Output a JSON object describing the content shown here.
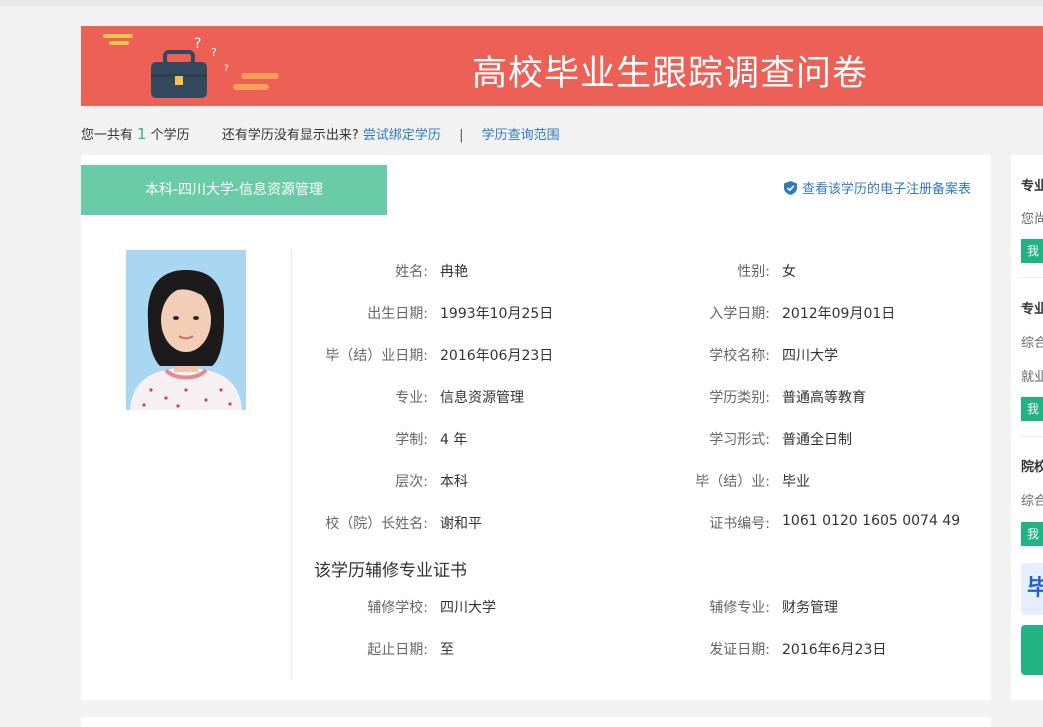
{
  "banner": {
    "title": "高校毕业生跟踪调查问卷"
  },
  "summary": {
    "prefix": "您一共有",
    "count": "1",
    "suffix": "个学历",
    "question": "还有学历没有显示出来?",
    "bind_link": "尝试绑定学历",
    "separator": "|",
    "range_link": "学历查询范围"
  },
  "record": {
    "tab_label": "本科-四川大学-信息资源管理",
    "reg_link": "查看该学历的电子注册备案表",
    "left_fields": [
      {
        "label": "姓名:",
        "value": "冉艳"
      },
      {
        "label": "出生日期:",
        "value": "1993年10月25日"
      },
      {
        "label": "毕（结）业日期:",
        "value": "2016年06月23日"
      },
      {
        "label": "专业:",
        "value": "信息资源管理"
      },
      {
        "label": "学制:",
        "value": "4 年"
      },
      {
        "label": "层次:",
        "value": "本科"
      },
      {
        "label": "校（院）长姓名:",
        "value": "谢和平"
      }
    ],
    "right_fields": [
      {
        "label": "性别:",
        "value": "女"
      },
      {
        "label": "入学日期:",
        "value": "2012年09月01日"
      },
      {
        "label": "学校名称:",
        "value": "四川大学"
      },
      {
        "label": "学历类别:",
        "value": "普通高等教育"
      },
      {
        "label": "学习形式:",
        "value": "普通全日制"
      },
      {
        "label": "毕（结）业:",
        "value": "毕业"
      },
      {
        "label": "证书编号:",
        "value": "1061 0120 1605 0074 49"
      }
    ],
    "minor_title": "该学历辅修专业证书",
    "minor_left": [
      {
        "label": "辅修学校:",
        "value": "四川大学"
      },
      {
        "label": "起止日期:",
        "value": "至"
      }
    ],
    "minor_right": [
      {
        "label": "辅修专业:",
        "value": "财务管理"
      },
      {
        "label": "发证日期:",
        "value": "2016年6月23日"
      }
    ]
  },
  "sidebar": {
    "heads": [
      "专业",
      "专业",
      "院校"
    ],
    "texts": [
      "您尚",
      "综合",
      "就业",
      "综合"
    ],
    "btn_label": "我",
    "logo_glyph": "毕"
  },
  "colors": {
    "banner": "#ec6055",
    "tab": "#69cba7",
    "link": "#2f7bbf",
    "accent": "#22b382"
  }
}
